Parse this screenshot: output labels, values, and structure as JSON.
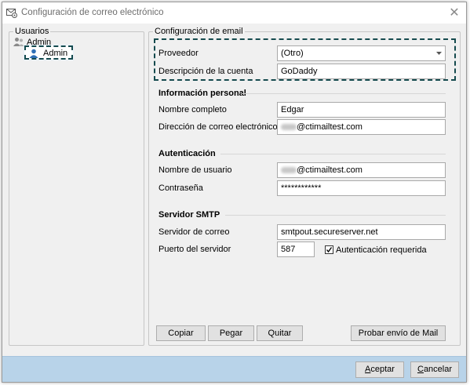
{
  "window": {
    "title": "Configuración de correo electrónico",
    "close_glyph": "✕",
    "icon": "mail-settings-icon"
  },
  "users": {
    "group_label": "Usuarios",
    "root_label": "Admin",
    "selected_user": "Admin"
  },
  "email_config": {
    "group_label": "Configuración de email",
    "provider_label": "Proveedor",
    "provider_value": "(Otro)",
    "account_desc_label": "Descripción de la cuenta",
    "account_desc_value": "GoDaddy"
  },
  "personal": {
    "heading": "Información personal",
    "full_name_label": "Nombre completo",
    "full_name_value": "Edgar",
    "email_label": "Dirección de correo electrónico",
    "email_value": "@ctimailtest.com"
  },
  "auth": {
    "heading": "Autenticación",
    "username_label": "Nombre de usuario",
    "username_value": "@ctimailtest.com",
    "password_label": "Contraseña",
    "password_value": "************"
  },
  "smtp": {
    "heading": "Servidor SMTP",
    "server_label": "Servidor de correo",
    "server_value": "smtpout.secureserver.net",
    "port_label": "Puerto del servidor",
    "port_value": "587",
    "auth_required_label": "Autenticación requerida",
    "auth_required_checked": true
  },
  "actions": {
    "copy": "Copiar",
    "paste": "Pegar",
    "remove": "Quitar",
    "test": "Probar envío de Mail"
  },
  "footer": {
    "accept_hotkey": "A",
    "accept_rest": "ceptar",
    "cancel_hotkey": "C",
    "cancel_rest": "ancelar"
  },
  "colors": {
    "footer": "#b8d3e9",
    "highlight": "#154a4e"
  }
}
